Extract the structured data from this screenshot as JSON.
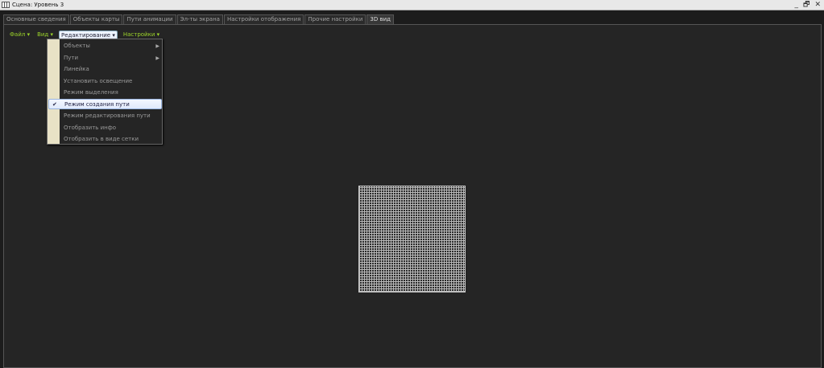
{
  "window": {
    "title": "Сцена: Уровень 3",
    "minimize": "_",
    "restore": "🗗",
    "close": "✕"
  },
  "tabs": [
    {
      "label": "Основные сведения"
    },
    {
      "label": "Объекты карты"
    },
    {
      "label": "Пути анимации"
    },
    {
      "label": "Эл-ты экрана"
    },
    {
      "label": "Настройки отображения"
    },
    {
      "label": "Прочие настройки"
    },
    {
      "label": "3D вид",
      "active": true
    }
  ],
  "menubar": [
    {
      "label": "Файл ▾"
    },
    {
      "label": "Вид ▾"
    },
    {
      "label": "Редактирование ▾"
    },
    {
      "label": "Настройки ▾"
    }
  ],
  "dropdown": {
    "items": [
      {
        "label": "Объекты",
        "submenu": true
      },
      {
        "label": "Пути",
        "submenu": true
      },
      {
        "label": "Линейка"
      },
      {
        "label": "Установить освещение"
      },
      {
        "label": "Режим выделения"
      },
      {
        "label": "Режим создания пути",
        "checked": true
      },
      {
        "label": "Режим редактирования пути"
      },
      {
        "label": "Отобразить инфо"
      },
      {
        "label": "Отобразить в виде сетки"
      }
    ],
    "arrow": "▶",
    "check": "✔"
  }
}
